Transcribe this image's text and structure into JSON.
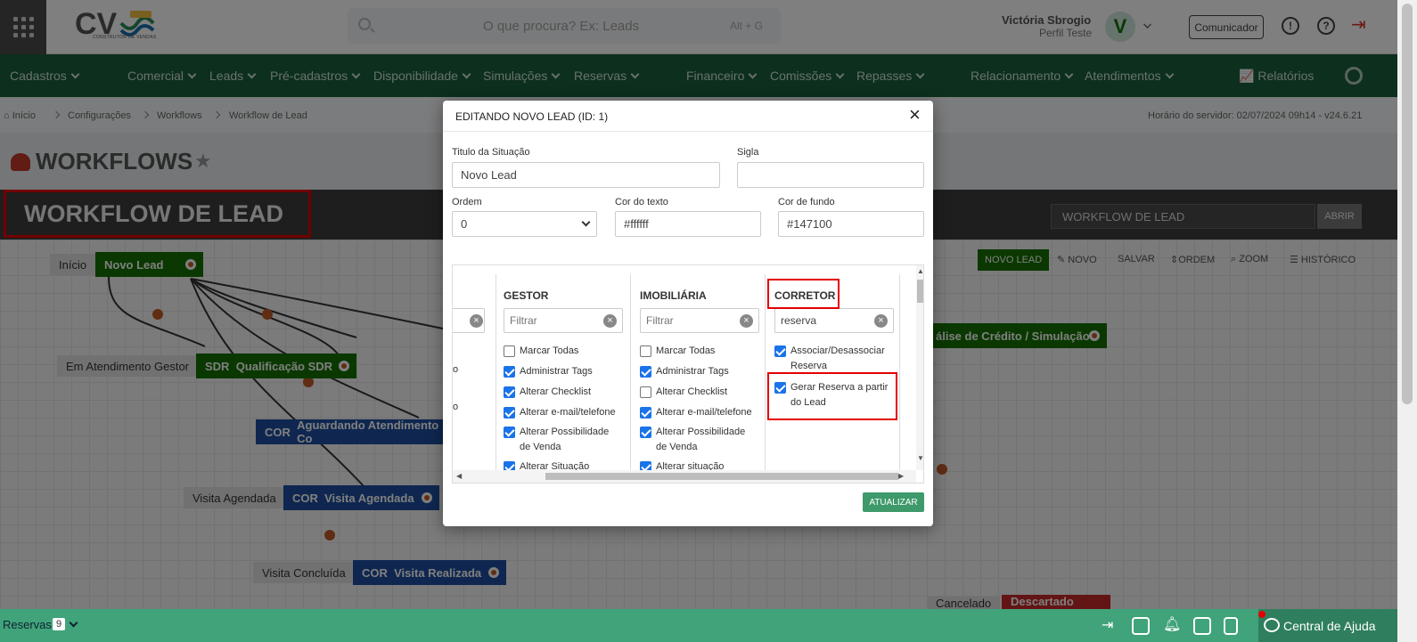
{
  "header": {
    "search_placeholder": "O que procura? Ex: Leads",
    "search_shortcut": "Alt + G",
    "user_name": "Victória Sbrogio",
    "user_profile": "Perfil Teste",
    "avatar_letter": "V",
    "comunicador": "Comunicador",
    "logo_text": "CV",
    "logo_sub": "CONSTRUTOR DE VENDAS"
  },
  "nav": {
    "items": [
      "Cadastros",
      "Comercial",
      "Leads",
      "Pré-cadastros",
      "Disponibilidade",
      "Simulações",
      "Reservas",
      "Financeiro",
      "Comissões",
      "Repasses",
      "Relacionamento",
      "Atendimentos"
    ],
    "reports": "Relatórios"
  },
  "breadcrumb": {
    "items": [
      "Início",
      "Configurações",
      "Workflows",
      "Workflow de Lead"
    ],
    "server_time": "Horário do servidor: 02/07/2024 09h14 - v24.6.21"
  },
  "page": {
    "title": "WORKFLOWS",
    "workflow_title": "WORKFLOW DE LEAD",
    "workflow_select": "WORKFLOW DE LEAD",
    "abrir": "ABRIR",
    "tools": [
      "NOVO LEAD",
      "NOVO",
      "SALVAR",
      "ORDEM",
      "ZOOM",
      "HISTÓRICO"
    ]
  },
  "workflow_nodes": {
    "inicio": "Início",
    "novo_lead": "Novo Lead",
    "em_atendimento": "Em Atendimento Gestor",
    "sdr_tag": "SDR",
    "sdr_node": "Qualificação SDR",
    "cor_tag": "COR",
    "aguardando": "Aguardando Atendimento Co",
    "visita_agendada_lbl": "Visita Agendada",
    "visita_agendada": "Visita Agendada",
    "visita_concluida_lbl": "Visita Concluída",
    "visita_realizada": "Visita Realizada",
    "analise": "álise de Crédito / Simulação",
    "cancelado": "Cancelado",
    "descartado": "Descartado"
  },
  "footer": {
    "reservas": "Reservas",
    "reservas_count": "9",
    "help": "Central de Ajuda"
  },
  "modal": {
    "title": "EDITANDO NOVO LEAD (ID: 1)",
    "close": "×",
    "titulo_label": "Titulo da Situação",
    "titulo_value": "Novo Lead",
    "sigla_label": "Sigla",
    "sigla_value": "",
    "ordem_label": "Ordem",
    "ordem_value": "0",
    "cor_texto_label": "Cor do texto",
    "cor_texto_value": "#ffffff",
    "cor_fundo_label": "Cor de fundo",
    "cor_fundo_value": "#147100",
    "filter_placeholder": "Filtrar",
    "partial_labels": [
      "o",
      "o"
    ],
    "columns": [
      {
        "header": "GESTOR",
        "filter": "",
        "items": [
          {
            "label": "Marcar Todas",
            "checked": false
          },
          {
            "label": "Administrar Tags",
            "checked": true
          },
          {
            "label": "Alterar Checklist",
            "checked": true
          },
          {
            "label": "Alterar e-mail/telefone",
            "checked": true
          },
          {
            "label": "Alterar Possibilidade de Venda",
            "checked": true
          },
          {
            "label": "Alterar Situação",
            "checked": true
          }
        ]
      },
      {
        "header": "IMOBILIÁRIA",
        "filter": "",
        "items": [
          {
            "label": "Marcar Todas",
            "checked": false
          },
          {
            "label": "Administrar Tags",
            "checked": true
          },
          {
            "label": "Alterar Checklist",
            "checked": false
          },
          {
            "label": "Alterar e-mail/telefone",
            "checked": true
          },
          {
            "label": "Alterar Possibilidade de Venda",
            "checked": true
          },
          {
            "label": "Alterar situação",
            "checked": true
          }
        ]
      },
      {
        "header": "CORRETOR",
        "filter": "reserva",
        "items": [
          {
            "label": "Associar/Desassociar Reserva",
            "checked": true
          },
          {
            "label": "Gerar Reserva a partir do Lead",
            "checked": true
          }
        ]
      }
    ],
    "update_button": "ATUALIZAR"
  },
  "colors": {
    "nav_bg": "#1b5f3a",
    "footer_bg": "#40a37a",
    "highlight": "#e30000",
    "node_green": "#147100",
    "node_blue": "#1f4fa0",
    "node_red": "#c62828",
    "update_button": "#3e9a6b"
  }
}
